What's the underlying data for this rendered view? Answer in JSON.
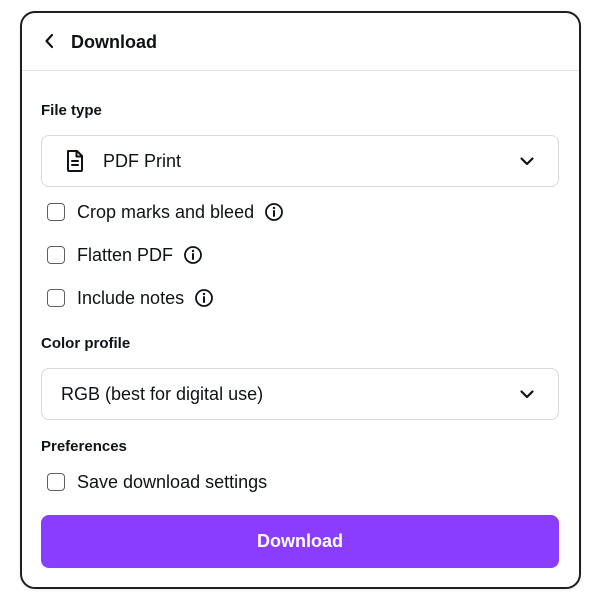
{
  "header": {
    "back_icon": "chevron-left-icon",
    "title": "Download"
  },
  "file_type": {
    "label": "File type",
    "icon": "document-icon",
    "selected": "PDF Print",
    "dropdown_icon": "chevron-down-icon"
  },
  "options": [
    {
      "label": "Crop marks and bleed",
      "checked": false,
      "has_info": true
    },
    {
      "label": "Flatten PDF",
      "checked": false,
      "has_info": true
    },
    {
      "label": "Include notes",
      "checked": false,
      "has_info": true
    }
  ],
  "color_profile": {
    "label": "Color profile",
    "selected": "RGB (best for digital use)",
    "dropdown_icon": "chevron-down-icon"
  },
  "preferences": {
    "label": "Preferences",
    "save_settings_label": "Save download settings",
    "save_settings_checked": false
  },
  "download_button": {
    "label": "Download"
  },
  "colors": {
    "accent": "#8b3dff",
    "border": "#1f1f1f",
    "text": "#0e1318"
  }
}
